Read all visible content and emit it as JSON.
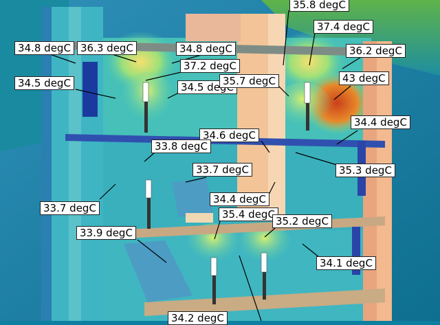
{
  "colors": {
    "sky": "#0e7fa2",
    "hot": "#d8531a",
    "warm": "#9fe07a",
    "cool": "#35b9c6",
    "wall": "#f3b98f",
    "floor": "#c9a27a"
  },
  "labels": [
    {
      "id": "t1",
      "text": "35.8 degC"
    },
    {
      "id": "t2",
      "text": "37.4 degC"
    },
    {
      "id": "t3",
      "text": "34.8 degC"
    },
    {
      "id": "t4",
      "text": "36.3 degC"
    },
    {
      "id": "t5",
      "text": "34.8 degC"
    },
    {
      "id": "t6",
      "text": "36.2 degC"
    },
    {
      "id": "t7",
      "text": "37.2 degC"
    },
    {
      "id": "t8",
      "text": "34.5 degC"
    },
    {
      "id": "t9",
      "text": "34.5 degC"
    },
    {
      "id": "t10",
      "text": "35.7 degC"
    },
    {
      "id": "t11",
      "text": "43 degC"
    },
    {
      "id": "t12",
      "text": "34.4 degC"
    },
    {
      "id": "t13",
      "text": "34.6 degC"
    },
    {
      "id": "t14",
      "text": "33.8 degC"
    },
    {
      "id": "t15",
      "text": "35.3 degC"
    },
    {
      "id": "t16",
      "text": "33.7 degC"
    },
    {
      "id": "t17",
      "text": "33.7 degC"
    },
    {
      "id": "t18",
      "text": "34.4 degC"
    },
    {
      "id": "t19",
      "text": "35.4 degC"
    },
    {
      "id": "t20",
      "text": "35.2 degC"
    },
    {
      "id": "t21",
      "text": "33.9 degC"
    },
    {
      "id": "t22",
      "text": "34.1 degC"
    },
    {
      "id": "t23",
      "text": "34.2 degC"
    }
  ]
}
